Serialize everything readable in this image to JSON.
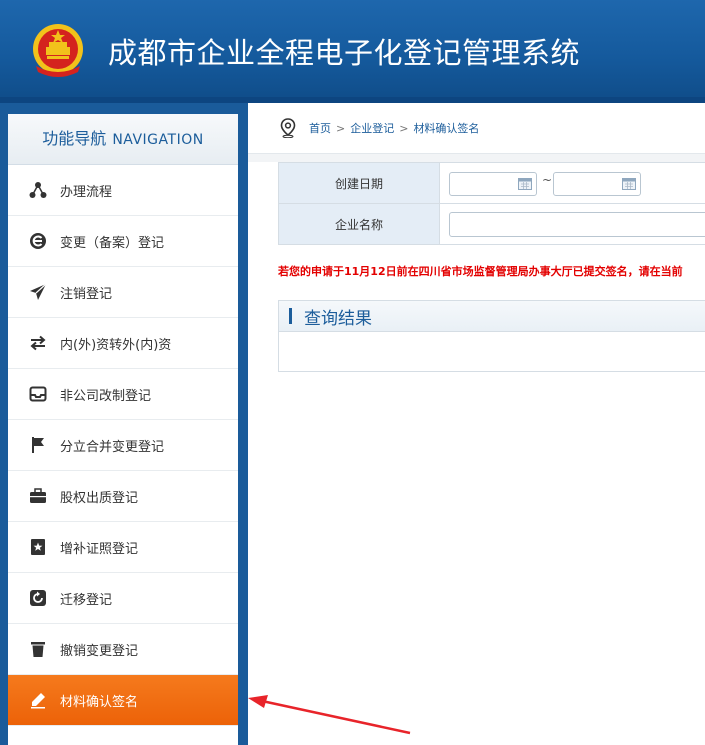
{
  "header": {
    "title": "成都市企业全程电子化登记管理系统",
    "emblem_icon": "national-emblem-icon"
  },
  "nav": {
    "title_cn": "功能导航",
    "title_en": "NAVIGATION",
    "items": [
      {
        "label": "办理流程",
        "icon": "flow-nodes-icon"
      },
      {
        "label": "变更（备案）登记",
        "icon": "change-e-icon"
      },
      {
        "label": "注销登记",
        "icon": "paper-plane-icon"
      },
      {
        "label": "内(外)资转外(内)资",
        "icon": "swap-arrows-icon"
      },
      {
        "label": "非公司改制登记",
        "icon": "inbox-icon"
      },
      {
        "label": "分立合并变更登记",
        "icon": "flag-icon"
      },
      {
        "label": "股权出质登记",
        "icon": "briefcase-icon"
      },
      {
        "label": "增补证照登记",
        "icon": "star-bookmark-icon"
      },
      {
        "label": "迁移登记",
        "icon": "relocate-icon"
      },
      {
        "label": "撤销变更登记",
        "icon": "trash-icon"
      },
      {
        "label": "材料确认签名",
        "icon": "pencil-icon",
        "active": true
      }
    ]
  },
  "breadcrumb": {
    "home": "首页",
    "level1": "企业登记",
    "current": "材料确认签名",
    "separator": ">"
  },
  "search": {
    "date_label": "创建日期",
    "date_separator": "~",
    "name_label": "企业名称"
  },
  "notice": "若您的申请于11月12日前在四川省市场监督管理局办事大厅已提交签名，请在当前",
  "results": {
    "title": "查询结果"
  },
  "colors": {
    "header_blue": "#155a9d",
    "active_orange": "#ec6208",
    "notice_red": "#e30000",
    "annotation_red": "#e8242a"
  }
}
